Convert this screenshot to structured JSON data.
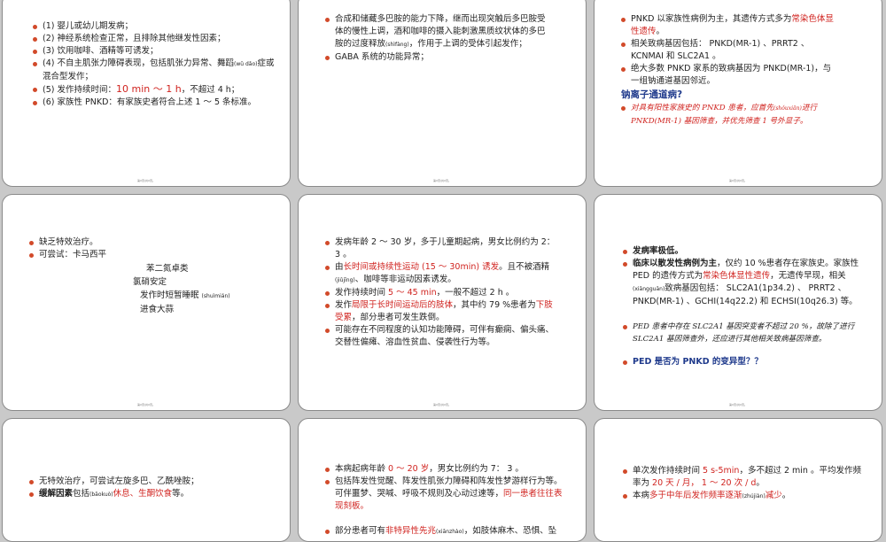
{
  "footer": "第X页/共X页。",
  "s1": {
    "items": [
      {
        "a": "(1) ",
        "b": "婴儿或幼儿期发病；"
      },
      {
        "a": "(2) ",
        "b": "神经系统检查正常，且排除其他继发性因素；"
      },
      {
        "a": "(3) ",
        "b": "饮用咖啡、酒精等可诱发；"
      },
      {
        "a": "(4) ",
        "b": "不自主肌张力障碍表现，包括肌张力异常、舞蹈",
        "c": "(wǔ dǎo)",
        "d": "症或混合型发作；"
      },
      {
        "a": "(5) ",
        "b": "发作持续时间：",
        "red": "10 min ～ 1 h",
        "c": "，不超过 4 h；"
      },
      {
        "a": "(6) ",
        "b": "家族性 PNKD：有家族史者符合上述 1 ～ 5 条标准。"
      }
    ]
  },
  "s2": {
    "items": [
      {
        "t": "合成和储藏多巴胺的能力下降，继而出现突触后多巴胺受体的慢性上调，酒和咖啡的摄入能刺激黑质纹状体的多巴胺的过度释放",
        "small": "(shìfàng)",
        "t2": "，作用于上调的受体引起发作；"
      },
      {
        "t": "GABA 系统的功能异常；"
      }
    ]
  },
  "s3": {
    "items": [
      {
        "t": "PNKD 以家族性病例为主，其遗传方式多为",
        "red": "常染色体显性遗传",
        "t2": "。"
      },
      {
        "t": "相关致病基因包括： PNKD(MR-1) 、PRRT2 、KCNMAI 和 SLC2A1 。"
      },
      {
        "t": "绝大多数 PNKD 家系的致病基因为 PNKD(MR-1)，与一组钠通道基因邻近。"
      }
    ],
    "heading": "钠离子通道病?",
    "red_item": "对具有阳性家族史的 PNKD 患者，应首先",
    "red_small": "(shǒuxiān)",
    "red_item2": "进行PNKD(MR-1) 基因筛查，并优先筛查 1 号外显子。"
  },
  "s4": {
    "items": [
      {
        "t": "缺乏特效治疗。"
      },
      {
        "t": "可尝试：卡马西平"
      }
    ],
    "plain": [
      "苯二氮卓类",
      "氯硝安定",
      "发作时短暂睡眠",
      "进食大蒜"
    ],
    "sleep_small": "(shuìmián)"
  },
  "s5": {
    "items": [
      {
        "t": "发病年龄 2 ～ 30 岁，多于儿童期起病，男女比例约为 2： 3 。"
      },
      {
        "t": "由",
        "red": "长时间或持续性运动 (15 ～ 30min) 诱发",
        "t2": "。且不被酒精",
        "small": "(jiǔjīng)",
        "t3": "、咖啡等非运动因素诱发。"
      },
      {
        "t": "发作持续时间 ",
        "red": "5 ～ 45 min",
        "t2": "，一般不超过 2 h 。"
      },
      {
        "t": "发作",
        "red": "局限于长时间运动后的肢体",
        "t2": "，其中约 79 %患者为",
        "red2": "下肢受累",
        "t3": "，部分患者可发生跌倒。"
      },
      {
        "t": "可能存在不同程度的认知功能障碍，可伴有癫痫、偏头痛、交替性偏瘫、溶血性贫血、侵袭性行为等。"
      }
    ]
  },
  "s6": {
    "items": [
      {
        "t": "发病率极低。"
      },
      {
        "t": "临床以散发性病例为主",
        "t2": "，仅约 10 %患者存在家族史。家族性 PED 的遗传方式为",
        "red": "常染色体显性遗传",
        "t3": "，无遗传早现，相关",
        "small": "(xiāngguān)",
        "t4": "致病基因包括： SLC2A1(1p34.2) 、 PRRT2 、 PNKD(MR-1) 、GCHI(14q22.2) 和 ECHSI(10q26.3) 等。"
      },
      {
        "t": "PED 患者中存在 SLC2A1 基因突变者不超过 20 %，故除了进行 SLC2A1 基因筛查外，还应进行其他相关致病基因筛查。"
      },
      {
        "t": "PED 是否为 PNKD 的变异型？？"
      }
    ]
  },
  "s7": {
    "items": [
      {
        "t": "无特效治疗，可尝试左旋多巴、乙酰唑胺；"
      },
      {
        "t": "缓解因素",
        "t2": "包括",
        "small": "(bāokuò)",
        "red": "休息、生酮饮食",
        "t3": "等。"
      }
    ]
  },
  "s8": {
    "items": [
      {
        "t": "本病起病年龄 ",
        "red": "0 ～ 20 岁",
        "t2": "，男女比例约为 7： 3 。"
      },
      {
        "t": "包括阵发性觉醒、阵发性肌张力障碍和阵发性梦游样行为等。可伴噩梦、哭喊、呼吸不规则及心动过速等，",
        "red": "同一患者往往表现刻板。"
      },
      {
        "t": "部分患者可有",
        "red": "非特异性先兆",
        "small": "(xiānzhào)",
        "t2": "，如肢体麻木、恐惧、坠"
      }
    ]
  },
  "s9": {
    "items": [
      {
        "t": "单次发作持续时间 ",
        "red": "5 s-5min",
        "t2": "，多不超过 2 min 。平均发作频率为 ",
        "red2": "20 天 / 月， 1 ～ 20 次 / d",
        "t3": "。"
      },
      {
        "t": "本病",
        "red": "多于中年后发作频率逐渐",
        "small": "(zhújiàn)",
        "red2": "减少",
        "t2": "。"
      }
    ]
  }
}
